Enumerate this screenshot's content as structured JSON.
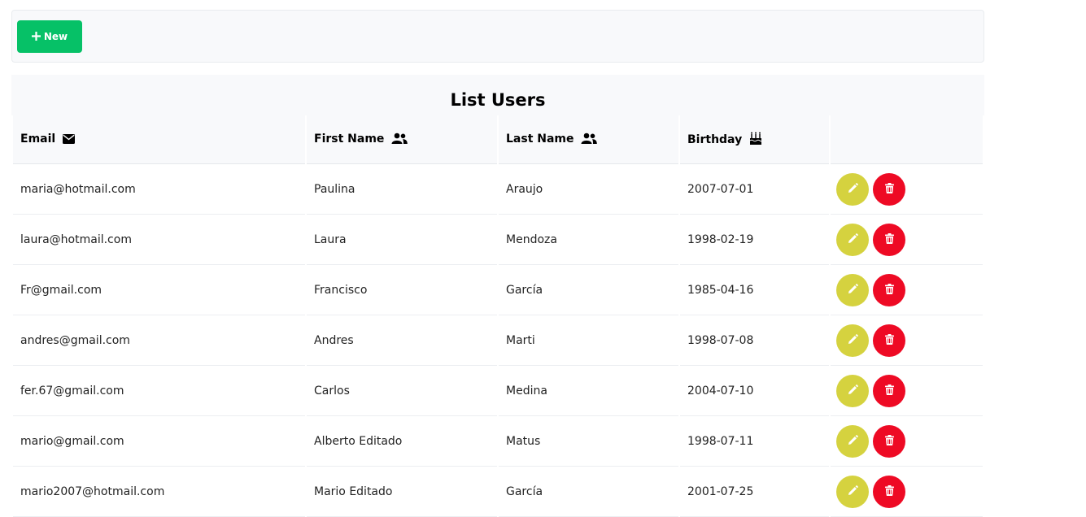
{
  "toolbar": {
    "new_label": "New"
  },
  "title": "List Users",
  "columns": {
    "email": "Email",
    "first_name": "First Name",
    "last_name": "Last Name",
    "birthday": "Birthday"
  },
  "rows": [
    {
      "email": "maria@hotmail.com",
      "first_name": "Paulina",
      "last_name": "Araujo",
      "birthday": "2007-07-01"
    },
    {
      "email": "laura@hotmail.com",
      "first_name": "Laura",
      "last_name": "Mendoza",
      "birthday": "1998-02-19"
    },
    {
      "email": "Fr@gmail.com",
      "first_name": "Francisco",
      "last_name": "García",
      "birthday": "1985-04-16"
    },
    {
      "email": "andres@gmail.com",
      "first_name": "Andres",
      "last_name": "Marti",
      "birthday": "1998-07-08"
    },
    {
      "email": "fer.67@gmail.com",
      "first_name": "Carlos",
      "last_name": "Medina",
      "birthday": "2004-07-10"
    },
    {
      "email": "mario@gmail.com",
      "first_name": "Alberto Editado",
      "last_name": "Matus",
      "birthday": "1998-07-11"
    },
    {
      "email": "mario2007@hotmail.com",
      "first_name": "Mario Editado",
      "last_name": "García",
      "birthday": "2001-07-25"
    }
  ],
  "colors": {
    "new_button": "#06c167",
    "edit_button": "#d5d23f",
    "delete_button": "#ee0a24",
    "header_bg": "#f8f9fb"
  },
  "icons": {
    "new": "plus-icon",
    "email": "envelope-icon",
    "first_name": "users-icon",
    "last_name": "users-icon",
    "birthday": "birthday-cake-icon",
    "edit": "pencil-icon",
    "delete": "trash-icon"
  }
}
